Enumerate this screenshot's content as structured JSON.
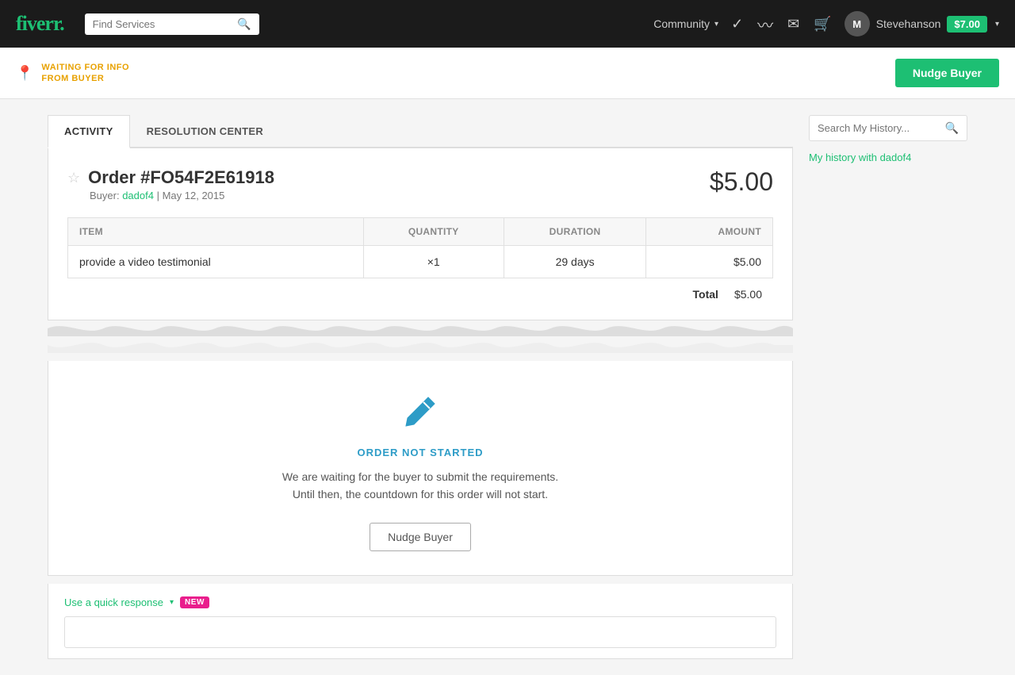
{
  "navbar": {
    "logo": "fiverr",
    "logo_dot": ".",
    "search_placeholder": "Find Services",
    "community_label": "Community",
    "username": "Stevehanson",
    "avatar_initial": "M",
    "balance": "$7.00",
    "icons": {
      "check": "✓",
      "chart": "∿",
      "mail": "✉",
      "cart": "🛒"
    }
  },
  "status_bar": {
    "status_line1": "WAITING FOR INFO",
    "status_line2": "FROM BUYER",
    "nudge_buyer_label": "Nudge Buyer"
  },
  "tabs": [
    {
      "id": "activity",
      "label": "ACTIVITY",
      "active": true
    },
    {
      "id": "resolution",
      "label": "RESOLUTION CENTER",
      "active": false
    }
  ],
  "order": {
    "title": "Order #FO54F2E61918",
    "price": "$5.00",
    "buyer_label": "Buyer:",
    "buyer_name": "dadof4",
    "date": "May 12, 2015",
    "table": {
      "headers": [
        "ITEM",
        "QUANTITY",
        "DURATION",
        "AMOUNT"
      ],
      "rows": [
        {
          "item": "provide a video testimonial",
          "quantity": "×1",
          "duration": "29 days",
          "amount": "$5.00"
        }
      ],
      "total_label": "Total",
      "total_value": "$5.00"
    }
  },
  "order_status": {
    "icon": "✏",
    "status_label": "ORDER NOT STARTED",
    "description_line1": "We are waiting for the buyer to submit the requirements.",
    "description_line2": "Until then, the countdown for this order will not start.",
    "nudge_label": "Nudge Buyer"
  },
  "quick_response": {
    "link_label": "Use a quick response",
    "new_badge": "NEW"
  },
  "sidebar": {
    "search_placeholder": "Search My History...",
    "history_link": "My history with dadof4"
  }
}
